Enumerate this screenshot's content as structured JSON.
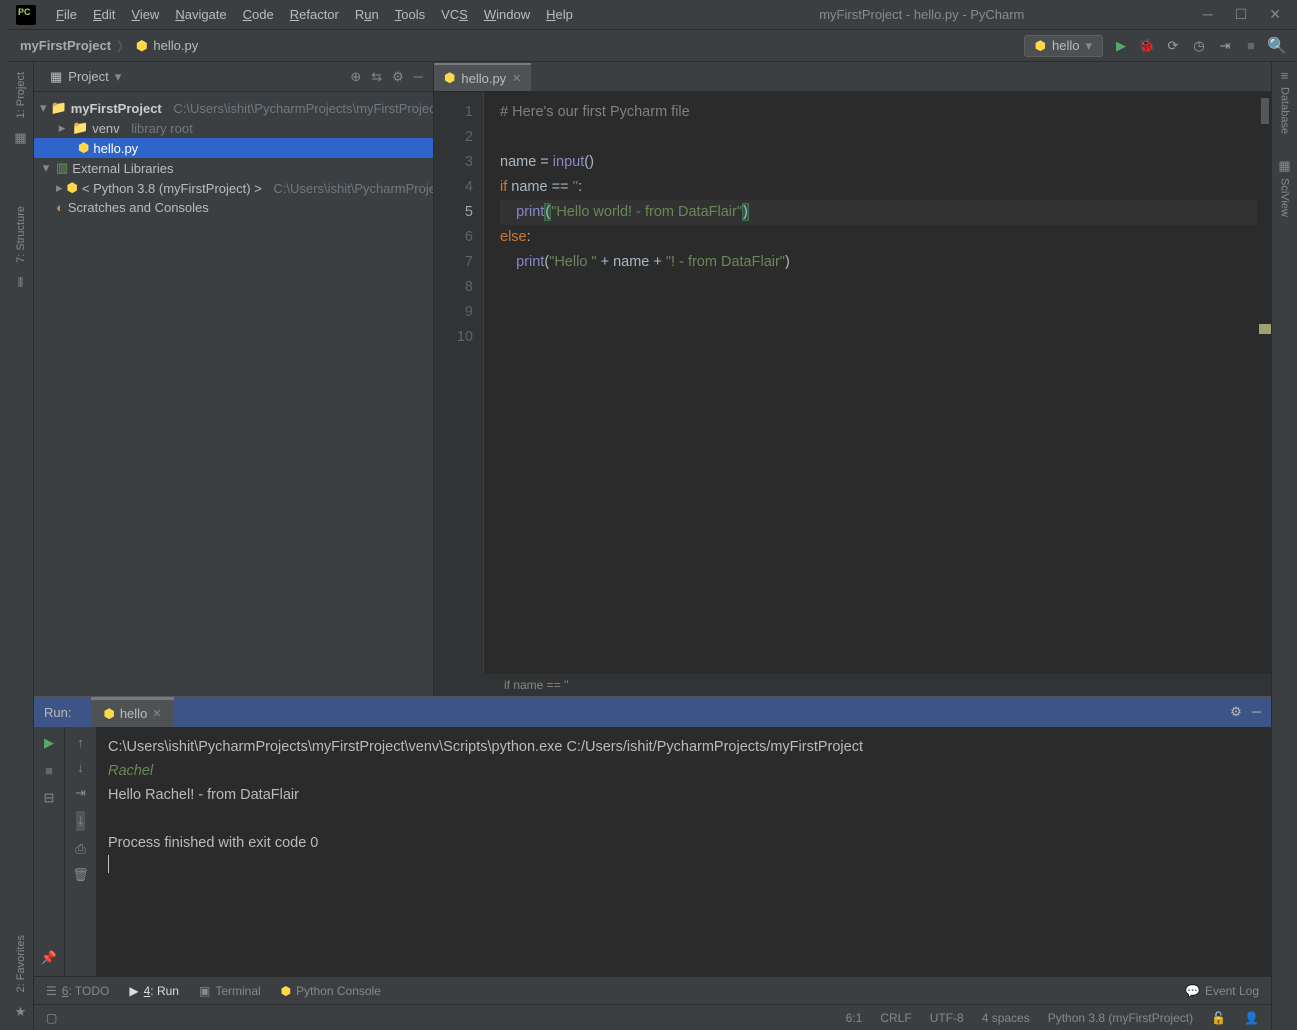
{
  "menu": {
    "file": "File",
    "edit": "Edit",
    "view": "View",
    "navigate": "Navigate",
    "code": "Code",
    "refactor": "Refactor",
    "run": "Run",
    "tools": "Tools",
    "vcs": "VCS",
    "window": "Window",
    "help": "Help"
  },
  "window_title": "myFirstProject - hello.py - PyCharm",
  "breadcrumb": {
    "project": "myFirstProject",
    "file": "hello.py"
  },
  "run_config": "hello",
  "left_tools": {
    "project": "1: Project",
    "structure": "7: Structure",
    "favorites": "2: Favorites"
  },
  "right_tools": {
    "database": "Database",
    "sciview": "SciView"
  },
  "project_panel": {
    "title": "Project",
    "root": "myFirstProject",
    "root_path": "C:\\Users\\ishit\\PycharmProjects\\myFirstProject",
    "venv": "venv",
    "venv_note": "library root",
    "file": "hello.py",
    "ext": "External Libraries",
    "python": "< Python 3.8 (myFirstProject) >",
    "python_path": "C:\\Users\\ishit\\PycharmProjects",
    "scratch": "Scratches and Consoles"
  },
  "tab": {
    "name": "hello.py"
  },
  "code": {
    "l1": "# Here's our first Pycharm file",
    "l2": "",
    "l3a": "name = ",
    "l3b": "input",
    "l3c": "()",
    "l4a": "if ",
    "l4b": "name == ",
    "l4c": "''",
    "l4d": ":",
    "l5a": "    ",
    "l5b": "print",
    "l5lp": "(",
    "l5c": "\"Hello world! - from DataFlair\"",
    "l5rp": ")",
    "l6a": "else",
    "l6b": ":",
    "l7a": "    ",
    "l7b": "print",
    "l7c": "(",
    "l7d": "\"Hello \"",
    "l7e": " + name + ",
    "l7f": "\"! - from DataFlair\"",
    "l7g": ")"
  },
  "editor_hint": "if name == ''",
  "run": {
    "label": "Run:",
    "tab": "hello",
    "cmd": "C:\\Users\\ishit\\PycharmProjects\\myFirstProject\\venv\\Scripts\\python.exe C:/Users/ishit/PycharmProjects/myFirstProject",
    "input": "Rachel",
    "out": "Hello Rachel! - from DataFlair",
    "exit": "Process finished with exit code 0"
  },
  "bottom": {
    "todo": "6: TODO",
    "run": "4: Run",
    "terminal": "Terminal",
    "pyconsole": "Python Console",
    "eventlog": "Event Log"
  },
  "status": {
    "pos": "6:1",
    "crlf": "CRLF",
    "enc": "UTF-8",
    "indent": "4 spaces",
    "interp": "Python 3.8 (myFirstProject)"
  }
}
